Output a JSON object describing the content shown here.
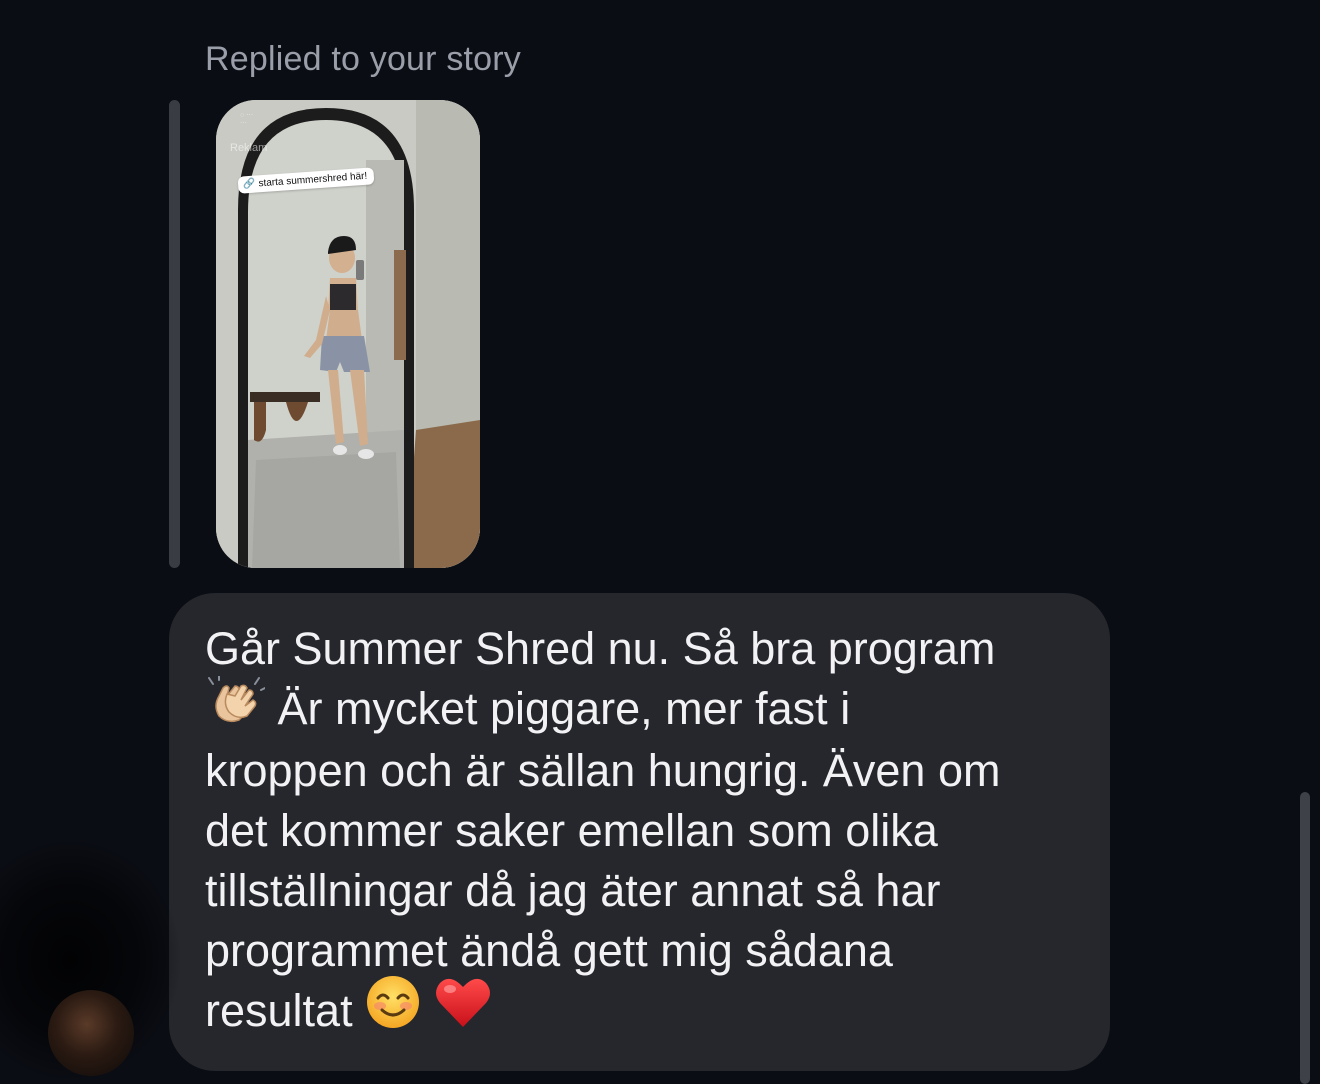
{
  "reply_header": {
    "label": "Replied to your story"
  },
  "story": {
    "link_sticker_text": "starta summershred här!",
    "ad_label": "Reklam",
    "link_icon": "link-icon"
  },
  "message": {
    "lines": [
      "Går Summer Shred nu. Så bra program",
      "Är mycket piggare, mer fast i",
      "kroppen och är sällan hungrig. Även om",
      "det kommer saker emellan som olika",
      "tillställningar då jag äter annat så har",
      "programmet ändå gett mig sådana",
      "resultat"
    ],
    "emojis": {
      "clapping": "clapping-hands-emoji",
      "smile": "smiling-face-emoji",
      "heart": "red-heart-emoji"
    }
  },
  "colors": {
    "background": "#0b0d14",
    "bubble": "#25272d",
    "text": "#f2f2f4",
    "muted": "#9a9ea8"
  }
}
